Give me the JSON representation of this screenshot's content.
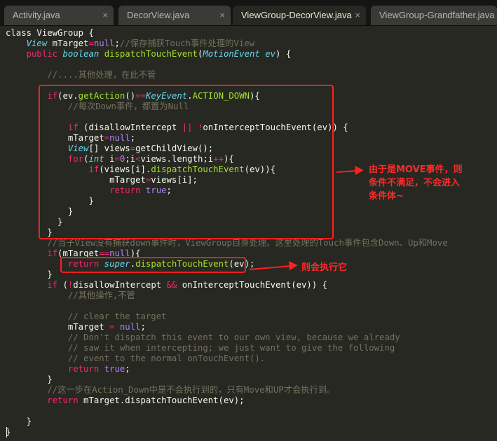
{
  "tabs": [
    {
      "label": "Activity.java",
      "close": "×",
      "active": false
    },
    {
      "label": "DecorView.java",
      "close": "×",
      "active": false
    },
    {
      "label": "ViewGroup-DecorView.java",
      "close": "×",
      "active": true
    },
    {
      "label": "ViewGroup-Grandfather.java",
      "close": "×",
      "active": false
    }
  ],
  "code": [
    [
      [
        "pl",
        "class ViewGroup {"
      ]
    ],
    [
      [
        "pl",
        "    "
      ],
      [
        "ty",
        "View"
      ],
      [
        "pl",
        " mTarget"
      ],
      [
        "kw",
        "="
      ],
      [
        "nm",
        "null"
      ],
      [
        "pl",
        ";"
      ],
      [
        "cm",
        "//保存捕获Touch事件处理的View"
      ]
    ],
    [
      [
        "pl",
        "    "
      ],
      [
        "kw",
        "public"
      ],
      [
        "pl",
        " "
      ],
      [
        "ty",
        "boolean"
      ],
      [
        "pl",
        " "
      ],
      [
        "sp",
        "dispatchTouchEvent"
      ],
      [
        "pl",
        "("
      ],
      [
        "ty",
        "MotionEvent"
      ],
      [
        "pl",
        " "
      ],
      [
        "ty",
        "ev"
      ],
      [
        "pl",
        ") {"
      ]
    ],
    [
      [
        "pl",
        ""
      ]
    ],
    [
      [
        "pl",
        "        "
      ],
      [
        "cm",
        "//....其他处理，在此不管"
      ]
    ],
    [
      [
        "pl",
        ""
      ]
    ],
    [
      [
        "pl",
        "        "
      ],
      [
        "kw",
        "if"
      ],
      [
        "pl",
        "(ev."
      ],
      [
        "sp",
        "getAction"
      ],
      [
        "pl",
        "()"
      ],
      [
        "kw",
        "=="
      ],
      [
        "ty",
        "KeyEvent"
      ],
      [
        "pl",
        "."
      ],
      [
        "sp",
        "ACTION_DOWN"
      ],
      [
        "pl",
        "){"
      ]
    ],
    [
      [
        "pl",
        "            "
      ],
      [
        "cm",
        "//每次Down事件，都置为Null"
      ]
    ],
    [
      [
        "pl",
        ""
      ]
    ],
    [
      [
        "pl",
        "            "
      ],
      [
        "kw",
        "if"
      ],
      [
        "pl",
        " (disallowIntercept "
      ],
      [
        "kw",
        "||"
      ],
      [
        "pl",
        " "
      ],
      [
        "kw",
        "!"
      ],
      [
        "pl",
        "onInterceptTouchEvent(ev)) {"
      ]
    ],
    [
      [
        "pl",
        "            mTarget"
      ],
      [
        "kw",
        "="
      ],
      [
        "nm",
        "null"
      ],
      [
        "pl",
        ";"
      ]
    ],
    [
      [
        "pl",
        "            "
      ],
      [
        "ty",
        "View"
      ],
      [
        "pl",
        "[] views"
      ],
      [
        "kw",
        "="
      ],
      [
        "pl",
        "getChildView();"
      ]
    ],
    [
      [
        "pl",
        "            "
      ],
      [
        "kw",
        "for"
      ],
      [
        "pl",
        "("
      ],
      [
        "ty",
        "int"
      ],
      [
        "pl",
        " i"
      ],
      [
        "kw",
        "="
      ],
      [
        "nm",
        "0"
      ],
      [
        "pl",
        ";i"
      ],
      [
        "kw",
        "<"
      ],
      [
        "pl",
        "views.length;i"
      ],
      [
        "kw",
        "++"
      ],
      [
        "pl",
        "){"
      ]
    ],
    [
      [
        "pl",
        "                "
      ],
      [
        "kw",
        "if"
      ],
      [
        "pl",
        "(views[i]."
      ],
      [
        "sp",
        "dispatchTouchEvent"
      ],
      [
        "pl",
        "(ev)){"
      ]
    ],
    [
      [
        "pl",
        "                    mTarget"
      ],
      [
        "kw",
        "="
      ],
      [
        "pl",
        "views[i];"
      ]
    ],
    [
      [
        "pl",
        "                    "
      ],
      [
        "kw",
        "return"
      ],
      [
        "pl",
        " "
      ],
      [
        "nm",
        "true"
      ],
      [
        "pl",
        ";"
      ]
    ],
    [
      [
        "pl",
        "                }"
      ]
    ],
    [
      [
        "pl",
        "            }"
      ]
    ],
    [
      [
        "pl",
        "          }"
      ]
    ],
    [
      [
        "pl",
        "        }"
      ]
    ],
    [
      [
        "pl",
        "        "
      ],
      [
        "cm",
        "//当子View没有捕获down事件时，ViewGroup自身处理。这里处理的Touch事件包含Down、Up和Move"
      ]
    ],
    [
      [
        "pl",
        "        "
      ],
      [
        "kw",
        "if"
      ],
      [
        "pl",
        "(mTarget"
      ],
      [
        "kw",
        "=="
      ],
      [
        "nm",
        "null"
      ],
      [
        "pl",
        "){"
      ]
    ],
    [
      [
        "pl",
        "            "
      ],
      [
        "kw",
        "return"
      ],
      [
        "pl",
        " "
      ],
      [
        "ty",
        "super"
      ],
      [
        "pl",
        "."
      ],
      [
        "sp",
        "dispatchTouchEvent"
      ],
      [
        "pl",
        "(ev);"
      ]
    ],
    [
      [
        "pl",
        "        }"
      ]
    ],
    [
      [
        "pl",
        "        "
      ],
      [
        "kw",
        "if"
      ],
      [
        "pl",
        " ("
      ],
      [
        "kw",
        "!"
      ],
      [
        "pl",
        "disallowIntercept "
      ],
      [
        "kw",
        "&&"
      ],
      [
        "pl",
        " onInterceptTouchEvent(ev)) {"
      ]
    ],
    [
      [
        "pl",
        "            "
      ],
      [
        "cm",
        "//其他操作,不管"
      ]
    ],
    [
      [
        "pl",
        ""
      ]
    ],
    [
      [
        "pl",
        "            "
      ],
      [
        "cm",
        "// clear the target"
      ]
    ],
    [
      [
        "pl",
        "            mTarget "
      ],
      [
        "kw",
        "="
      ],
      [
        "pl",
        " "
      ],
      [
        "nm",
        "null"
      ],
      [
        "pl",
        ";"
      ]
    ],
    [
      [
        "pl",
        "            "
      ],
      [
        "cm",
        "// Don't dispatch this event to our own view, because we already"
      ]
    ],
    [
      [
        "pl",
        "            "
      ],
      [
        "cm",
        "// saw it when intercepting; we just want to give the following"
      ]
    ],
    [
      [
        "pl",
        "            "
      ],
      [
        "cm",
        "// event to the normal onTouchEvent()."
      ]
    ],
    [
      [
        "pl",
        "            "
      ],
      [
        "kw",
        "return"
      ],
      [
        "pl",
        " "
      ],
      [
        "nm",
        "true"
      ],
      [
        "pl",
        ";"
      ]
    ],
    [
      [
        "pl",
        "        }"
      ]
    ],
    [
      [
        "pl",
        "        "
      ],
      [
        "cm",
        "//这一步在Action_Down中是不会执行到的，只有Move和UP才会执行到。"
      ]
    ],
    [
      [
        "pl",
        "        "
      ],
      [
        "kw",
        "return"
      ],
      [
        "pl",
        " mTarget.dispatchTouchEvent(ev);"
      ]
    ],
    [
      [
        "pl",
        ""
      ]
    ],
    [
      [
        "pl",
        "    }"
      ]
    ],
    [
      [
        "pl",
        "}"
      ]
    ]
  ],
  "annotations": {
    "note1": "由于是MOVE事件，则\n条件不满足，不会进入\n条件体~",
    "note2": "则会执行它"
  },
  "colors": {
    "background": "#272822",
    "keyword": "#f92672",
    "type": "#66d9ef",
    "function": "#a6e22e",
    "constant": "#ae81ff",
    "comment": "#75715e",
    "annotation": "#ff2a2a"
  }
}
